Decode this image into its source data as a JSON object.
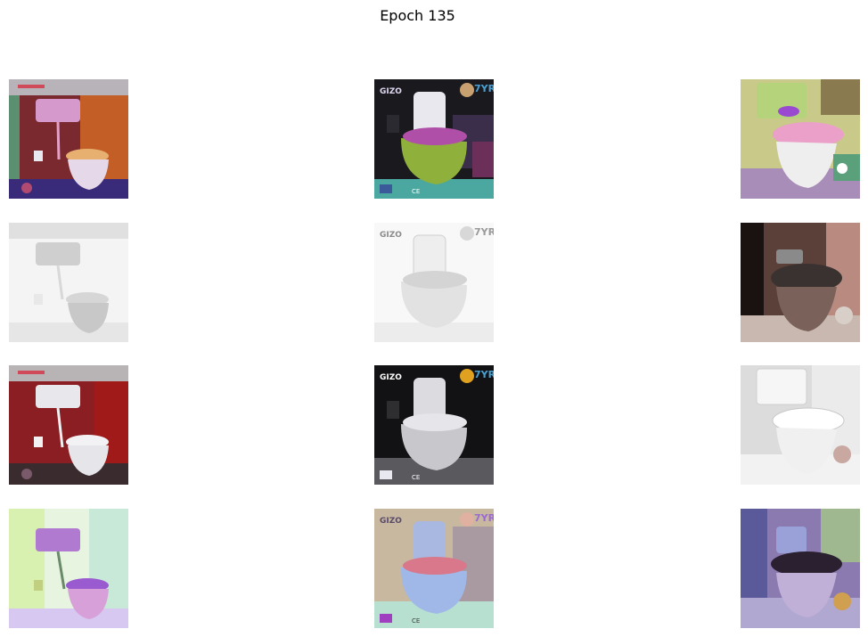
{
  "figure": {
    "title": "Epoch 135"
  },
  "grid": {
    "rows": 4,
    "cols": 3,
    "images": [
      {
        "row": 0,
        "col": 0,
        "subject": "toilet",
        "palette": "colorized-red-orange-purple"
      },
      {
        "row": 0,
        "col": 1,
        "subject": "toilet",
        "palette": "colorized-green-purple",
        "logo": "GIZO",
        "badge": "7YR"
      },
      {
        "row": 0,
        "col": 2,
        "subject": "toilet",
        "palette": "colorized-pink-lime"
      },
      {
        "row": 1,
        "col": 0,
        "subject": "toilet",
        "palette": "grayscale-light"
      },
      {
        "row": 1,
        "col": 1,
        "subject": "toilet",
        "palette": "grayscale-light",
        "logo": "GIZO",
        "badge": "7YR"
      },
      {
        "row": 1,
        "col": 2,
        "subject": "toilet",
        "palette": "dark-brown"
      },
      {
        "row": 2,
        "col": 0,
        "subject": "toilet",
        "palette": "original-red-wall"
      },
      {
        "row": 2,
        "col": 1,
        "subject": "toilet",
        "palette": "original-dark",
        "logo": "GIZO",
        "badge": "7YR"
      },
      {
        "row": 2,
        "col": 2,
        "subject": "toilet",
        "palette": "original-white"
      },
      {
        "row": 3,
        "col": 0,
        "subject": "toilet",
        "palette": "colorized-pastel-purple"
      },
      {
        "row": 3,
        "col": 1,
        "subject": "toilet",
        "palette": "colorized-pastel-blue",
        "logo": "GIZO",
        "badge": "7YR"
      },
      {
        "row": 3,
        "col": 2,
        "subject": "toilet",
        "palette": "colorized-blue-dark"
      }
    ]
  },
  "logo_text": "GIZO",
  "badge_text": "7YR",
  "ce_mark": "CE"
}
